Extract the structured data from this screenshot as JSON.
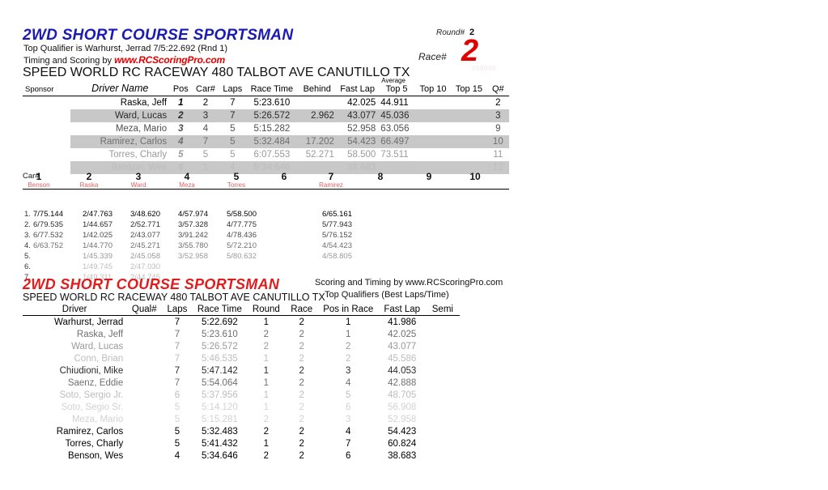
{
  "section1": {
    "title": "2WD SHORT COURSE SPORTSMAN",
    "top_qualifier": "Top Qualifier is Warhurst, Jerrad 7/5:22.692 (Rnd 1)",
    "timing_label": "Timing and Scoring by ",
    "timing_url": "www.RCScoringPro.com",
    "venue": "SPEED WORLD RC RACEWAY 480 TALBOT AVE CANUTILLO TX",
    "ghost_number": "999999",
    "round_label": "Round#",
    "round_value": "2",
    "race_label": "Race#",
    "race_value": "2",
    "headers": {
      "sponsor": "Sponsor",
      "driver": "Driver Name",
      "pos": "Pos",
      "car": "Car#",
      "laps": "Laps",
      "race_time": "Race Time",
      "behind": "Behind",
      "fast_lap": "Fast Lap",
      "average": "Average",
      "top5": "Top 5",
      "top10": "Top 10",
      "top15": "Top 15",
      "q": "Q#"
    },
    "rows": [
      {
        "sponsor": "",
        "driver": "Raska, Jeff",
        "pos": "1",
        "car": "2",
        "laps": "7",
        "race_time": "5:23.610",
        "behind": "",
        "fast_lap": "42.025",
        "top5": "44.911",
        "top10": "",
        "top15": "",
        "q": "2"
      },
      {
        "sponsor": "",
        "driver": "Ward, Lucas",
        "pos": "2",
        "car": "3",
        "laps": "7",
        "race_time": "5:26.572",
        "behind": "2.962",
        "fast_lap": "43.077",
        "top5": "45.036",
        "top10": "",
        "top15": "",
        "q": "3"
      },
      {
        "sponsor": "",
        "driver": "Meza, Mario",
        "pos": "3",
        "car": "4",
        "laps": "5",
        "race_time": "5:15.282",
        "behind": "",
        "fast_lap": "52.958",
        "top5": "63.056",
        "top10": "",
        "top15": "",
        "q": "9"
      },
      {
        "sponsor": "",
        "driver": "Ramirez, Carlos",
        "pos": "4",
        "car": "7",
        "laps": "5",
        "race_time": "5:32.484",
        "behind": "17.202",
        "fast_lap": "54.423",
        "top5": "66.497",
        "top10": "",
        "top15": "",
        "q": "10"
      },
      {
        "sponsor": "",
        "driver": "Torres, Charly",
        "pos": "5",
        "car": "5",
        "laps": "5",
        "race_time": "6:07.553",
        "behind": "52.271",
        "fast_lap": "58.500",
        "top5": "73.511",
        "top10": "",
        "top15": "",
        "q": "11"
      },
      {
        "sponsor": "",
        "driver": "Benson, Wes",
        "pos": "6",
        "car": "1",
        "laps": "4",
        "race_time": "5:34.646",
        "behind": "",
        "fast_lap": "38.683",
        "top5": "",
        "top10": "",
        "top15": "",
        "q": "12"
      }
    ]
  },
  "lap_grid": {
    "car_label": "Car#",
    "columns": [
      {
        "num": "1",
        "name": "Benson"
      },
      {
        "num": "2",
        "name": "Raska"
      },
      {
        "num": "3",
        "name": "Ward"
      },
      {
        "num": "4",
        "name": "Meza"
      },
      {
        "num": "5",
        "name": "Torres"
      },
      {
        "num": "6",
        "name": ""
      },
      {
        "num": "7",
        "name": "Ramirez"
      },
      {
        "num": "8",
        "name": ""
      },
      {
        "num": "9",
        "name": ""
      },
      {
        "num": "10",
        "name": ""
      }
    ],
    "lap_numbers": [
      "1.",
      "2.",
      "3.",
      "4.",
      "5.",
      "6.",
      "7."
    ],
    "laps": [
      [
        "7/75.144",
        "2/47.763",
        "3/48.620",
        "4/57.974",
        "5/58.500",
        "",
        "6/65.161",
        "",
        "",
        ""
      ],
      [
        "6/79.535",
        "1/44.657",
        "2/52.771",
        "3/57.328",
        "4/77.775",
        "",
        "5/77.943",
        "",
        "",
        ""
      ],
      [
        "6/77.532",
        "1/42.025",
        "2/43.077",
        "3/91.242",
        "4/78.436",
        "",
        "5/76.152",
        "",
        "",
        ""
      ],
      [
        "6/63.752",
        "1/44.770",
        "2/45.271",
        "3/55.780",
        "5/72.210",
        "",
        "4/54.423",
        "",
        "",
        ""
      ],
      [
        "",
        "1/45.339",
        "2/45.058",
        "3/52.958",
        "5/80.632",
        "",
        "4/58.805",
        "",
        "",
        ""
      ],
      [
        "",
        "1/49.745",
        "2/47.030",
        "",
        "",
        "",
        "",
        "",
        "",
        ""
      ],
      [
        "",
        "1/49.311",
        "2/44.745",
        "",
        "",
        "",
        "",
        "",
        "",
        ""
      ]
    ]
  },
  "section2": {
    "title": "2WD SHORT COURSE SPORTSMAN",
    "venue": "SPEED WORLD RC RACEWAY 480 TALBOT AVE CANUTILLO TX",
    "scoring_by": "Scoring and Timing by www.RCScoringPro.com",
    "subtitle": "Top Qualifiers (Best Laps/Time)",
    "headers": {
      "driver": "Driver",
      "qual": "Qual#",
      "laps": "Laps",
      "race_time": "Race Time",
      "round": "Round",
      "race": "Race",
      "pos_in_race": "Pos in Race",
      "fast_lap": "Fast Lap",
      "semi": "Semi"
    },
    "rows": [
      {
        "driver": "Warhurst, Jerrad",
        "qual": "",
        "laps": "7",
        "race_time": "5:22.692",
        "round": "1",
        "race": "2",
        "pos_in_race": "1",
        "fast_lap": "41.986",
        "semi": ""
      },
      {
        "driver": "Raska, Jeff",
        "qual": "",
        "laps": "7",
        "race_time": "5:23.610",
        "round": "2",
        "race": "2",
        "pos_in_race": "1",
        "fast_lap": "42.025",
        "semi": ""
      },
      {
        "driver": "Ward, Lucas",
        "qual": "",
        "laps": "7",
        "race_time": "5:26.572",
        "round": "2",
        "race": "2",
        "pos_in_race": "2",
        "fast_lap": "43.077",
        "semi": ""
      },
      {
        "driver": "Conn, Brian",
        "qual": "",
        "laps": "7",
        "race_time": "5:46.535",
        "round": "1",
        "race": "2",
        "pos_in_race": "2",
        "fast_lap": "45.586",
        "semi": ""
      },
      {
        "driver": "Chiudioni, Mike",
        "qual": "",
        "laps": "7",
        "race_time": "5:47.142",
        "round": "1",
        "race": "2",
        "pos_in_race": "3",
        "fast_lap": "44.053",
        "semi": ""
      },
      {
        "driver": "Saenz, Eddie",
        "qual": "",
        "laps": "7",
        "race_time": "5:54.064",
        "round": "1",
        "race": "2",
        "pos_in_race": "4",
        "fast_lap": "42.888",
        "semi": ""
      },
      {
        "driver": "Soto, Sergio Jr.",
        "qual": "",
        "laps": "6",
        "race_time": "5:37.956",
        "round": "1",
        "race": "2",
        "pos_in_race": "5",
        "fast_lap": "48.705",
        "semi": ""
      },
      {
        "driver": "Soto, Segio Sr.",
        "qual": "",
        "laps": "5",
        "race_time": "5:14.120",
        "round": "1",
        "race": "2",
        "pos_in_race": "6",
        "fast_lap": "56.908",
        "semi": ""
      },
      {
        "driver": "Meza, Mario",
        "qual": "",
        "laps": "5",
        "race_time": "5:15.281",
        "round": "2",
        "race": "2",
        "pos_in_race": "3",
        "fast_lap": "52.958",
        "semi": ""
      },
      {
        "driver": "Ramirez, Carlos",
        "qual": "",
        "laps": "5",
        "race_time": "5:32.483",
        "round": "2",
        "race": "2",
        "pos_in_race": "4",
        "fast_lap": "54.423",
        "semi": ""
      },
      {
        "driver": "Torres, Charly",
        "qual": "",
        "laps": "5",
        "race_time": "5:41.432",
        "round": "1",
        "race": "2",
        "pos_in_race": "7",
        "fast_lap": "60.824",
        "semi": ""
      },
      {
        "driver": "Benson, Wes",
        "qual": "",
        "laps": "4",
        "race_time": "5:34.646",
        "round": "2",
        "race": "2",
        "pos_in_race": "6",
        "fast_lap": "38.683",
        "semi": ""
      }
    ]
  }
}
